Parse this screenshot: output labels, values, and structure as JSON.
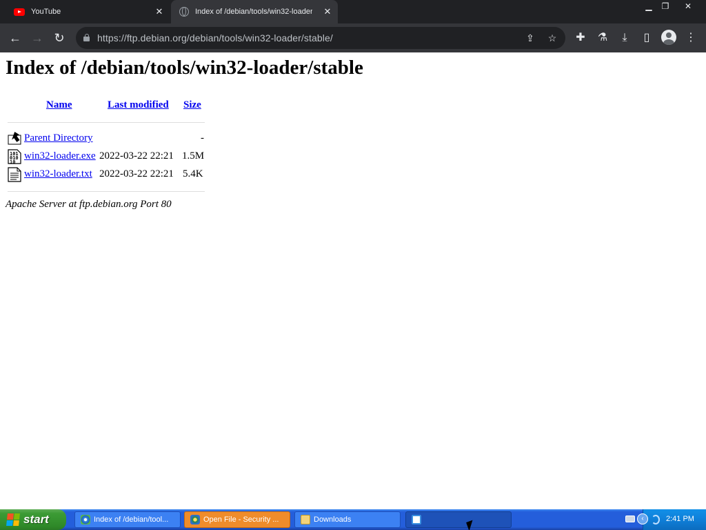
{
  "browser": {
    "tabs": [
      {
        "title": "YouTube",
        "icon": "youtube-icon"
      },
      {
        "title": "Index of /debian/tools/win32-loader/stable/",
        "icon": "globe-icon"
      }
    ],
    "url": "https://ftp.debian.org/debian/tools/win32-loader/stable/"
  },
  "page": {
    "heading": "Index of /debian/tools/win32-loader/stable",
    "columns": {
      "name": "Name",
      "modified": "Last modified",
      "size": "Size"
    },
    "rows": [
      {
        "name": "Parent Directory",
        "modified": "",
        "size": "-",
        "icon": "back-folder-icon"
      },
      {
        "name": "win32-loader.exe",
        "modified": "2022-03-22 22:21",
        "size": "1.5M",
        "icon": "binary-file-icon"
      },
      {
        "name": "win32-loader.txt",
        "modified": "2022-03-22 22:21",
        "size": "5.4K",
        "icon": "text-file-icon"
      }
    ],
    "address": "Apache Server at ftp.debian.org Port 80"
  },
  "taskbar": {
    "start_label": "start",
    "buttons": [
      {
        "label": "Index of /debian/tool...",
        "state": "normal"
      },
      {
        "label": "Open File - Security ...",
        "state": "flash"
      },
      {
        "label": "Downloads",
        "state": "normal"
      },
      {
        "label": "",
        "state": "active"
      }
    ],
    "clock": "2:41 PM"
  },
  "colors": {
    "tab_strip": "#202124",
    "toolbar": "#35363a",
    "link": "#0000ee",
    "taskbar_blue": "#245edb",
    "start_green": "#3c9b35"
  }
}
